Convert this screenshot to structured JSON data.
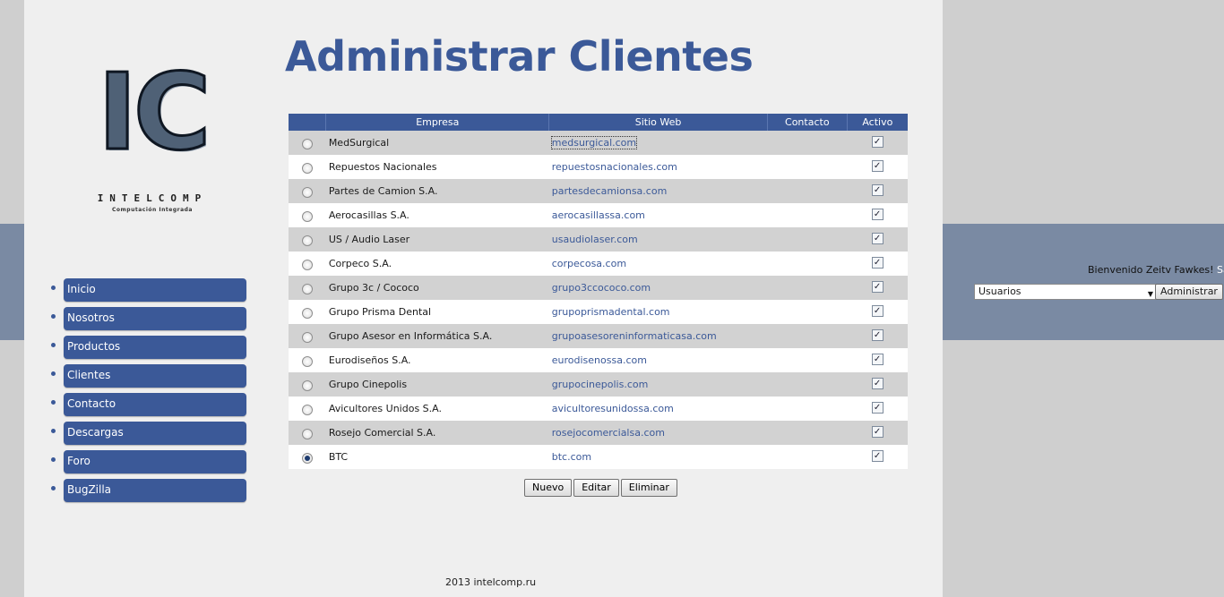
{
  "logo": {
    "letters": "IC",
    "wordmark": "INTELCOMP",
    "tagline": "Computación Integrada"
  },
  "page_title": "Administrar Clientes",
  "nav": {
    "items": [
      {
        "label": "Inicio"
      },
      {
        "label": "Nosotros"
      },
      {
        "label": "Productos"
      },
      {
        "label": "Clientes"
      },
      {
        "label": "Contacto"
      },
      {
        "label": "Descargas"
      },
      {
        "label": "Foro"
      },
      {
        "label": "BugZilla"
      }
    ]
  },
  "table": {
    "headers": {
      "select": "",
      "empresa": "Empresa",
      "sitio": "Sitio Web",
      "contacto": "Contacto",
      "activo": "Activo"
    },
    "rows": [
      {
        "empresa": "MedSurgical",
        "sitio": "medsurgical.com",
        "contacto": "",
        "activo": true,
        "selected": false
      },
      {
        "empresa": "Repuestos Nacionales",
        "sitio": "repuestosnacionales.com",
        "contacto": "",
        "activo": true,
        "selected": false
      },
      {
        "empresa": "Partes de Camion S.A.",
        "sitio": "partesdecamionsa.com",
        "contacto": "",
        "activo": true,
        "selected": false
      },
      {
        "empresa": "Aerocasillas S.A.",
        "sitio": "aerocasillassa.com",
        "contacto": "",
        "activo": true,
        "selected": false
      },
      {
        "empresa": "US / Audio Laser",
        "sitio": "usaudiolaser.com",
        "contacto": "",
        "activo": true,
        "selected": false
      },
      {
        "empresa": "Corpeco S.A.",
        "sitio": "corpecosa.com",
        "contacto": "",
        "activo": true,
        "selected": false
      },
      {
        "empresa": "Grupo 3c / Cococo",
        "sitio": "grupo3ccococo.com",
        "contacto": "",
        "activo": true,
        "selected": false
      },
      {
        "empresa": "Grupo Prisma Dental",
        "sitio": "grupoprismadental.com",
        "contacto": "",
        "activo": true,
        "selected": false
      },
      {
        "empresa": "Grupo Asesor en Informática S.A.",
        "sitio": "grupoasesoreninformaticasa.com",
        "contacto": "",
        "activo": true,
        "selected": false
      },
      {
        "empresa": "Eurodiseños S.A.",
        "sitio": "eurodisenossa.com",
        "contacto": "",
        "activo": true,
        "selected": false
      },
      {
        "empresa": "Grupo Cinepolis",
        "sitio": "grupocinepolis.com",
        "contacto": "",
        "activo": true,
        "selected": false
      },
      {
        "empresa": "Avicultores Unidos S.A.",
        "sitio": "avicultoresunidossa.com",
        "contacto": "",
        "activo": true,
        "selected": false
      },
      {
        "empresa": "Rosejo Comercial S.A.",
        "sitio": "rosejocomercialsa.com",
        "contacto": "",
        "activo": true,
        "selected": false
      },
      {
        "empresa": "BTC",
        "sitio": "btc.com",
        "contacto": "",
        "activo": true,
        "selected": true
      }
    ]
  },
  "actions": {
    "nuevo": "Nuevo",
    "editar": "Editar",
    "eliminar": "Eliminar"
  },
  "footer": "2013 intelcomp.ru",
  "user_panel": {
    "welcome": "Bienvenido Zeitv Fawkes!",
    "logout": "Salir?",
    "select_value": "Usuarios",
    "admin_button": "Administrar"
  },
  "colors": {
    "accent": "#3b5998",
    "band": "#7a8aa3",
    "row_alt": "#d2d2d2"
  }
}
